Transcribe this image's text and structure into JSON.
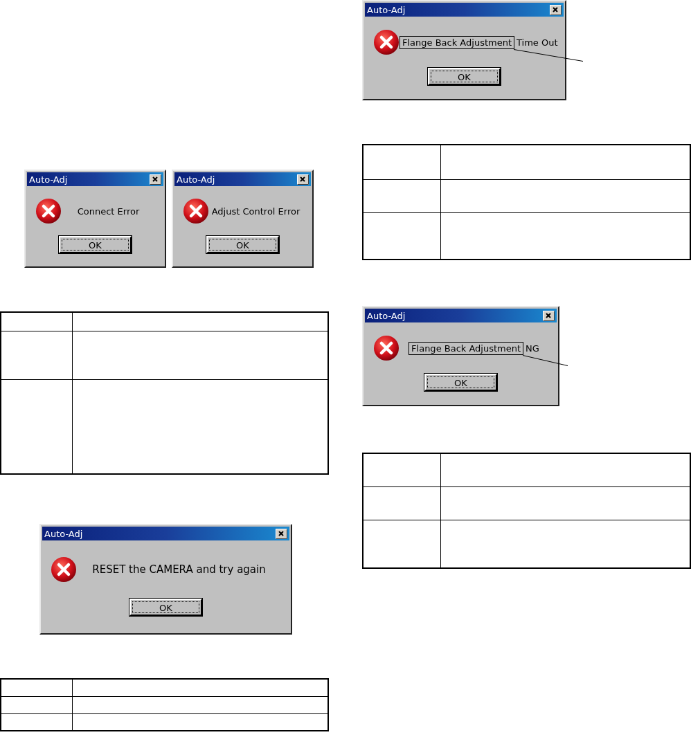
{
  "left_column": {
    "dialog_pair": [
      {
        "title": "Auto-Adj",
        "message": [
          {
            "text": "Connect Error",
            "boxed": false
          }
        ],
        "button": "OK"
      },
      {
        "title": "Auto-Adj",
        "message": [
          {
            "text": "Adjust Control Error",
            "boxed": false
          }
        ],
        "button": "OK"
      }
    ],
    "reset_dialog": {
      "title": "Auto-Adj",
      "message": [
        {
          "text": "RESET the CAMERA and try again",
          "boxed": false
        }
      ],
      "button": "OK"
    }
  },
  "right_column": {
    "dialogs": [
      {
        "title": "Auto-Adj",
        "message": [
          {
            "text": "Flange Back Adjustment",
            "boxed": true
          },
          {
            "text": "Time Out",
            "boxed": false
          }
        ],
        "button": "OK"
      },
      {
        "title": "Auto-Adj",
        "message": [
          {
            "text": "Flange Back Adjustment",
            "boxed": true
          },
          {
            "text": "NG",
            "boxed": false
          }
        ],
        "button": "OK"
      }
    ]
  }
}
